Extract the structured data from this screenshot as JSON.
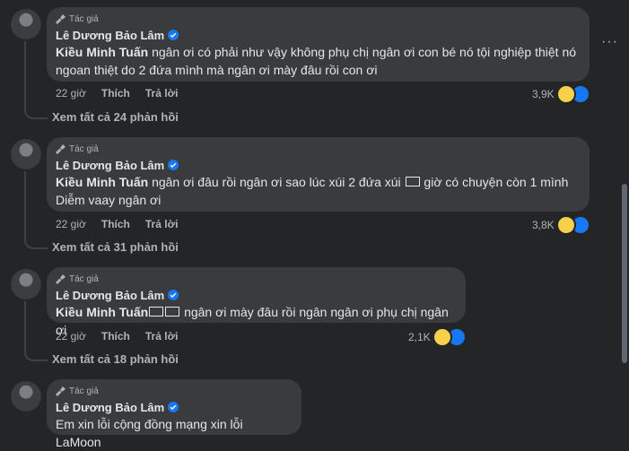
{
  "comments": [
    {
      "badge": "Tác giả",
      "author": "Lê Dương Bảo Lâm",
      "mention": "Kiều Minh Tuấn",
      "text_before": " ngân ơi có phải như vậy không phụ chị ngân ơi con bé nó tội nghiệp thiệt nó",
      "text_line2": "ngoan thiệt do 2 đứa mình mà ngân ơi mày đâu rồi con ơi",
      "time": "22 giờ",
      "like": "Thích",
      "reply": "Trả lời",
      "reactions": "3,9K",
      "view_replies": "Xem tất cả 24 phản hồi",
      "more": "···"
    },
    {
      "badge": "Tác giả",
      "author": "Lê Dương Bảo Lâm",
      "mention": "Kiều Minh Tuấn",
      "text_before": " ngân ơi đâu rồi ngân ơi sao lúc xúi 2 đứa xúi ",
      "text_after": " giờ có chuyện còn 1 mình",
      "text_line2": "Diễm vaay ngân ơi",
      "time": "22 giờ",
      "like": "Thích",
      "reply": "Trả lời",
      "reactions": "3,8K",
      "view_replies": "Xem tất cả 31 phản hồi"
    },
    {
      "badge": "Tác giả",
      "author": "Lê Dương Bảo Lâm",
      "mention": "Kiều Minh Tuấn",
      "text_after": " ngân ơi mày đâu rồi ngân ngân ơi phụ chị ngân ơi",
      "time": "22 giờ",
      "like": "Thích",
      "reply": "Trả lời",
      "reactions": "2,1K",
      "view_replies": "Xem tất cả 18 phản hồi"
    },
    {
      "badge": "Tác giả",
      "author": "Lê Dương Bảo Lâm",
      "text": "Em xin lỗi cộng đồng mạng xin lỗi LaMoon"
    }
  ],
  "colors": {
    "background": "#242526",
    "bubble": "#3a3b3c",
    "verified": "#1877f2",
    "haha": "#f7d14c",
    "like": "#1877f2"
  },
  "icons": [
    "microphone-icon",
    "verified-badge-icon",
    "haha-reaction-icon",
    "like-reaction-icon",
    "more-options-icon"
  ]
}
